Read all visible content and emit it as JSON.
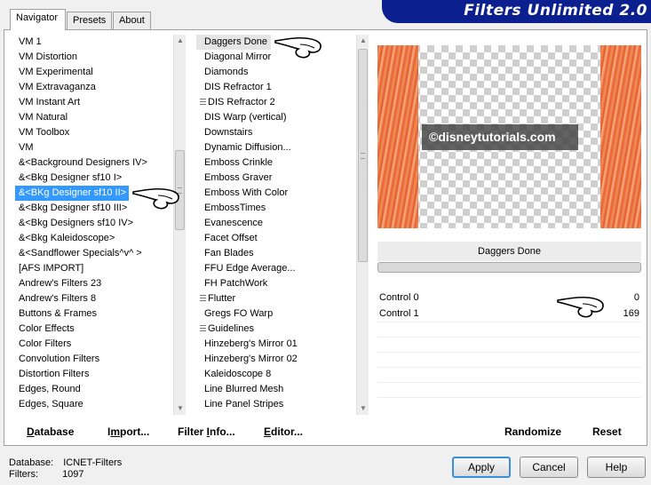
{
  "title": "Filters Unlimited 2.0",
  "tabs": [
    {
      "label": "Navigator",
      "active": true
    },
    {
      "label": "Presets",
      "active": false
    },
    {
      "label": "About",
      "active": false
    }
  ],
  "categories": [
    {
      "label": "VM 1"
    },
    {
      "label": "VM Distortion"
    },
    {
      "label": "VM Experimental"
    },
    {
      "label": "VM Extravaganza"
    },
    {
      "label": "VM Instant Art"
    },
    {
      "label": "VM Natural"
    },
    {
      "label": "VM Toolbox"
    },
    {
      "label": "VM"
    },
    {
      "label": "&<Background Designers IV>"
    },
    {
      "label": "&<Bkg Designer sf10 I>"
    },
    {
      "label": "&<BKg Designer sf10 II>",
      "selected": true
    },
    {
      "label": "&<Bkg Designer sf10 III>"
    },
    {
      "label": "&<Bkg Designers sf10 IV>"
    },
    {
      "label": "&<Bkg Kaleidoscope>"
    },
    {
      "label": "&<Sandflower Specials^v^ >"
    },
    {
      "label": "[AFS IMPORT]"
    },
    {
      "label": "Andrew's Filters 23"
    },
    {
      "label": "Andrew's Filters 8"
    },
    {
      "label": "Buttons & Frames"
    },
    {
      "label": "Color Effects"
    },
    {
      "label": "Color Filters"
    },
    {
      "label": "Convolution Filters"
    },
    {
      "label": "Distortion Filters"
    },
    {
      "label": "Edges, Round"
    },
    {
      "label": "Edges, Square"
    }
  ],
  "filters": [
    {
      "label": "Daggers Done",
      "highlighted": true
    },
    {
      "label": "Diagonal Mirror"
    },
    {
      "label": "Diamonds"
    },
    {
      "label": "DIS Refractor 1"
    },
    {
      "label": "DIS Refractor 2",
      "grip": true
    },
    {
      "label": "DIS Warp (vertical)"
    },
    {
      "label": "Downstairs"
    },
    {
      "label": "Dynamic Diffusion..."
    },
    {
      "label": "Emboss Crinkle"
    },
    {
      "label": "Emboss Graver"
    },
    {
      "label": "Emboss With Color"
    },
    {
      "label": "EmbossTimes"
    },
    {
      "label": "Evanescence"
    },
    {
      "label": "Facet Offset"
    },
    {
      "label": "Fan Blades"
    },
    {
      "label": "FFU Edge Average..."
    },
    {
      "label": "FH PatchWork"
    },
    {
      "label": "Flutter",
      "grip": true
    },
    {
      "label": "Gregs FO Warp"
    },
    {
      "label": "Guidelines",
      "grip": true
    },
    {
      "label": "Hinzeberg's Mirror 01"
    },
    {
      "label": "Hinzeberg's Mirror 02"
    },
    {
      "label": "Kaleidoscope 8"
    },
    {
      "label": "Line Blurred Mesh"
    },
    {
      "label": "Line Panel Stripes"
    }
  ],
  "preview": {
    "watermark": "©disneytutorials.com",
    "colors": {
      "strip": "#e8612c",
      "checker": "#cfcfcf"
    }
  },
  "parameters": {
    "filter_name": "Daggers Done",
    "controls": [
      {
        "label": "Control 0",
        "value": "0"
      },
      {
        "label": "Control  1",
        "value": "169"
      }
    ]
  },
  "left_buttons": {
    "database_first": "D",
    "database_rest": "atabase",
    "import_pre": "I",
    "import_first": "m",
    "import_rest": "port...",
    "filterinfo_pre": "Filter ",
    "filterinfo_first": "I",
    "filterinfo_rest": "nfo...",
    "editor_first": "E",
    "editor_rest": "ditor..."
  },
  "right_buttons": {
    "randomize": "Randomize",
    "reset": "Reset"
  },
  "status": {
    "database_label": "Database:",
    "database_value": "ICNET-Filters",
    "filters_label": "Filters:",
    "filters_value": "1097"
  },
  "dialog_buttons": {
    "apply": "Apply",
    "cancel": "Cancel",
    "help": "Help"
  },
  "accent_color": "#0b1f8f",
  "selection_color": "#3399ff"
}
